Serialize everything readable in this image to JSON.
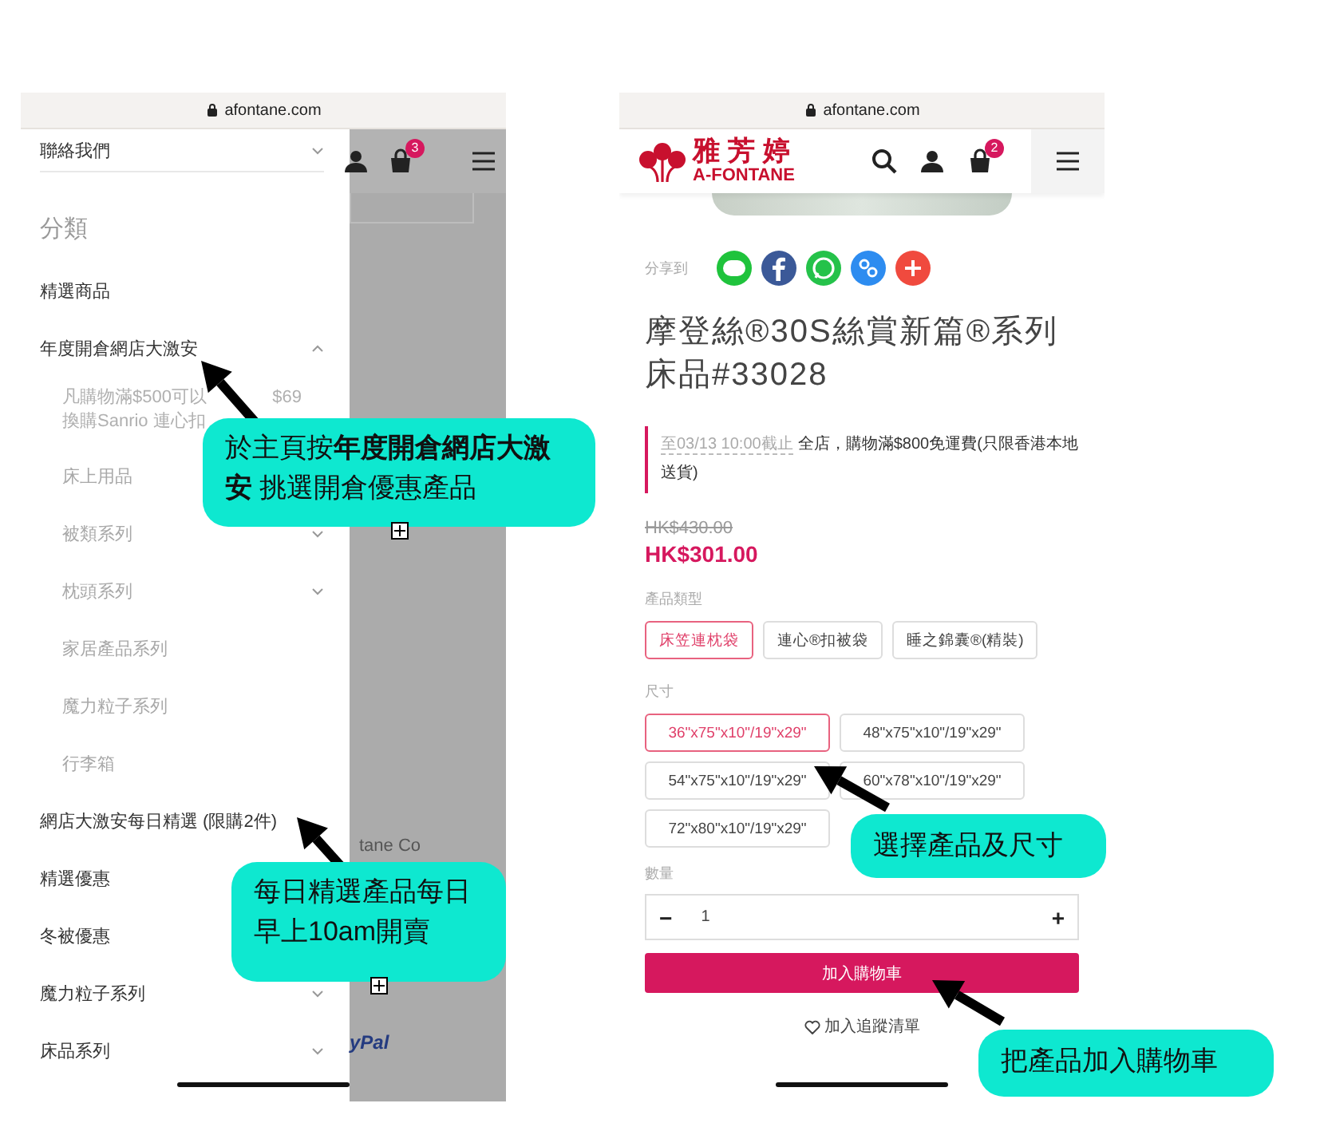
{
  "left_phone": {
    "address": "afontane.com",
    "contact_item": "聯絡我們",
    "section_title": "分類",
    "cart_count": "3",
    "background_texts": [
      "tane Co",
      "yPal"
    ],
    "menu_items": [
      {
        "label": "精選商品",
        "kind": "link"
      },
      {
        "label": "年度開倉網店大激安",
        "kind": "folder",
        "expanded": true,
        "children": [
          {
            "kind": "note",
            "lines": [
              [
                "凡購物滿$500可以",
                "$69"
              ],
              [
                "換購Sanrio 連心扣"
              ]
            ]
          },
          {
            "label": "床上用品",
            "kind": "link"
          },
          {
            "label": "被類系列",
            "kind": "folder",
            "expanded": false
          },
          {
            "label": "枕頭系列",
            "kind": "folder",
            "expanded": false
          },
          {
            "label": "家居產品系列",
            "kind": "link"
          },
          {
            "label": "魔力粒子系列",
            "kind": "link"
          },
          {
            "label": "行李箱",
            "kind": "link"
          }
        ]
      },
      {
        "label": "網店大激安每日精選 (限購2件)",
        "kind": "link"
      },
      {
        "label": "精選優惠",
        "kind": "link"
      },
      {
        "label": "冬被優惠",
        "kind": "link"
      },
      {
        "label": "魔力粒子系列",
        "kind": "folder",
        "expanded": false
      },
      {
        "label": "床品系列",
        "kind": "folder",
        "expanded": false
      }
    ]
  },
  "right_phone": {
    "address": "afontane.com",
    "brand_name": "雅芳婷",
    "brand_latin": "A-FONTANE",
    "cart_count": "2",
    "share_label": "分享到",
    "share_buttons": [
      {
        "kind": "line",
        "color": "#1fc33c"
      },
      {
        "kind": "facebook",
        "color": "#3b5998"
      },
      {
        "kind": "whatsapp",
        "color": "#25c24a"
      },
      {
        "kind": "link",
        "color": "#2d8cf0"
      },
      {
        "kind": "more",
        "color": "#f04a3e"
      }
    ],
    "title": "摩登絲®30S絲賞新篇®系列床品#33028",
    "promo": {
      "deadline": "至03/13 10:00截止",
      "text": "全店，購物滿$800免運費(只限香港本地送貨)"
    },
    "original_price": "HK$430.00",
    "price": "HK$301.00",
    "type_label": "產品類型",
    "types": [
      {
        "label": "床笠連枕袋",
        "selected": true
      },
      {
        "label": "連心®扣被袋",
        "selected": false
      },
      {
        "label": "睡之錦囊®(精裝)",
        "selected": false
      }
    ],
    "size_label": "尺寸",
    "sizes": [
      {
        "label": "36\"x75\"x10\"/19\"x29\"",
        "selected": true
      },
      {
        "label": "48\"x75\"x10\"/19\"x29\"",
        "selected": false
      },
      {
        "label": "54\"x75\"x10\"/19\"x29\"",
        "selected": false
      },
      {
        "label": "60\"x78\"x10\"/19\"x29\"",
        "selected": false
      },
      {
        "label": "72\"x80\"x10\"/19\"x29\"",
        "selected": false
      }
    ],
    "quantity_label": "數量",
    "minus": "−",
    "quantity": "1",
    "plus": "+",
    "add_to_cart": "加入購物車",
    "wishlist": "加入追蹤清單"
  },
  "callouts": [
    {
      "text": "於主頁按**年度開倉網店大激安** 挑選開倉優惠產品"
    },
    {
      "text": "每日精選產品每日早上10am開賣"
    },
    {
      "text": "選擇產品及尺寸"
    },
    {
      "text": "把產品加入購物車"
    }
  ]
}
